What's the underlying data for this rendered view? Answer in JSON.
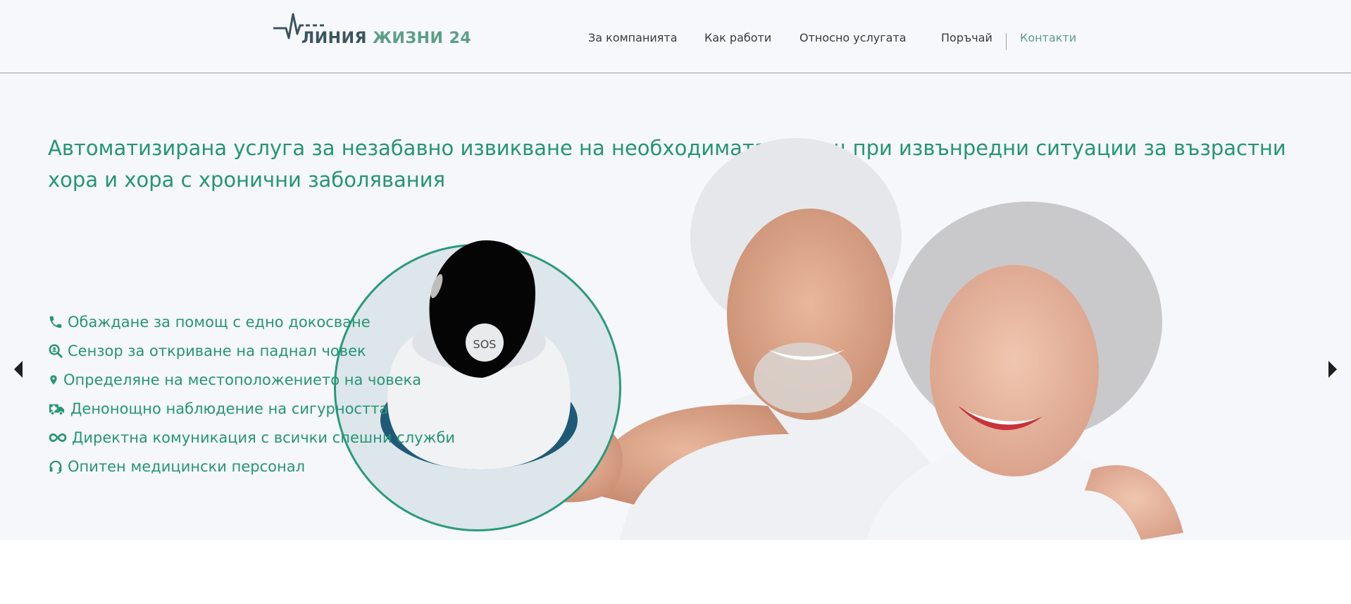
{
  "header": {
    "logo": {
      "word1": "ЛИНИЯ",
      "word2": "ЖИЗНИ 24",
      "icon": "heartbeat-line-icon"
    },
    "nav": [
      {
        "label": "За компанията",
        "active": false
      },
      {
        "label": "Как работи",
        "active": false
      },
      {
        "label": "Относно услугата",
        "active": false
      },
      {
        "label": "Поръчай",
        "active": false
      },
      {
        "label": "Контакти",
        "active": true
      }
    ]
  },
  "hero": {
    "title": "Автоматизирана услуга за незабавно извикване на необходимата помощ при извънредни ситуации за възрастни хора и хора с хронични заболявания",
    "device_label": "SOS",
    "features": [
      {
        "icon": "phone-icon",
        "text": "Обаждане за помощ с едно докосване"
      },
      {
        "icon": "search-person-icon",
        "text": "Сензор за откриване на паднал човек"
      },
      {
        "icon": "map-marker-icon",
        "text": "Определяне на местоположението на човека"
      },
      {
        "icon": "ambulance-icon",
        "text": "Денонощно наблюдение на сигурността"
      },
      {
        "icon": "infinity-icon",
        "text": "Директна комуникация с всички спешни служби"
      },
      {
        "icon": "headset-icon",
        "text": "Опитен медицински персонал"
      }
    ],
    "carousel": {
      "prev_icon": "arrow-left-icon",
      "next_icon": "arrow-right-icon"
    }
  },
  "colors": {
    "accent": "#249673",
    "logo_dark": "#3a5560",
    "logo_green": "#5c9e86",
    "hero_bg": "#f6f7fb",
    "header_bg": "#f7f8fc"
  }
}
